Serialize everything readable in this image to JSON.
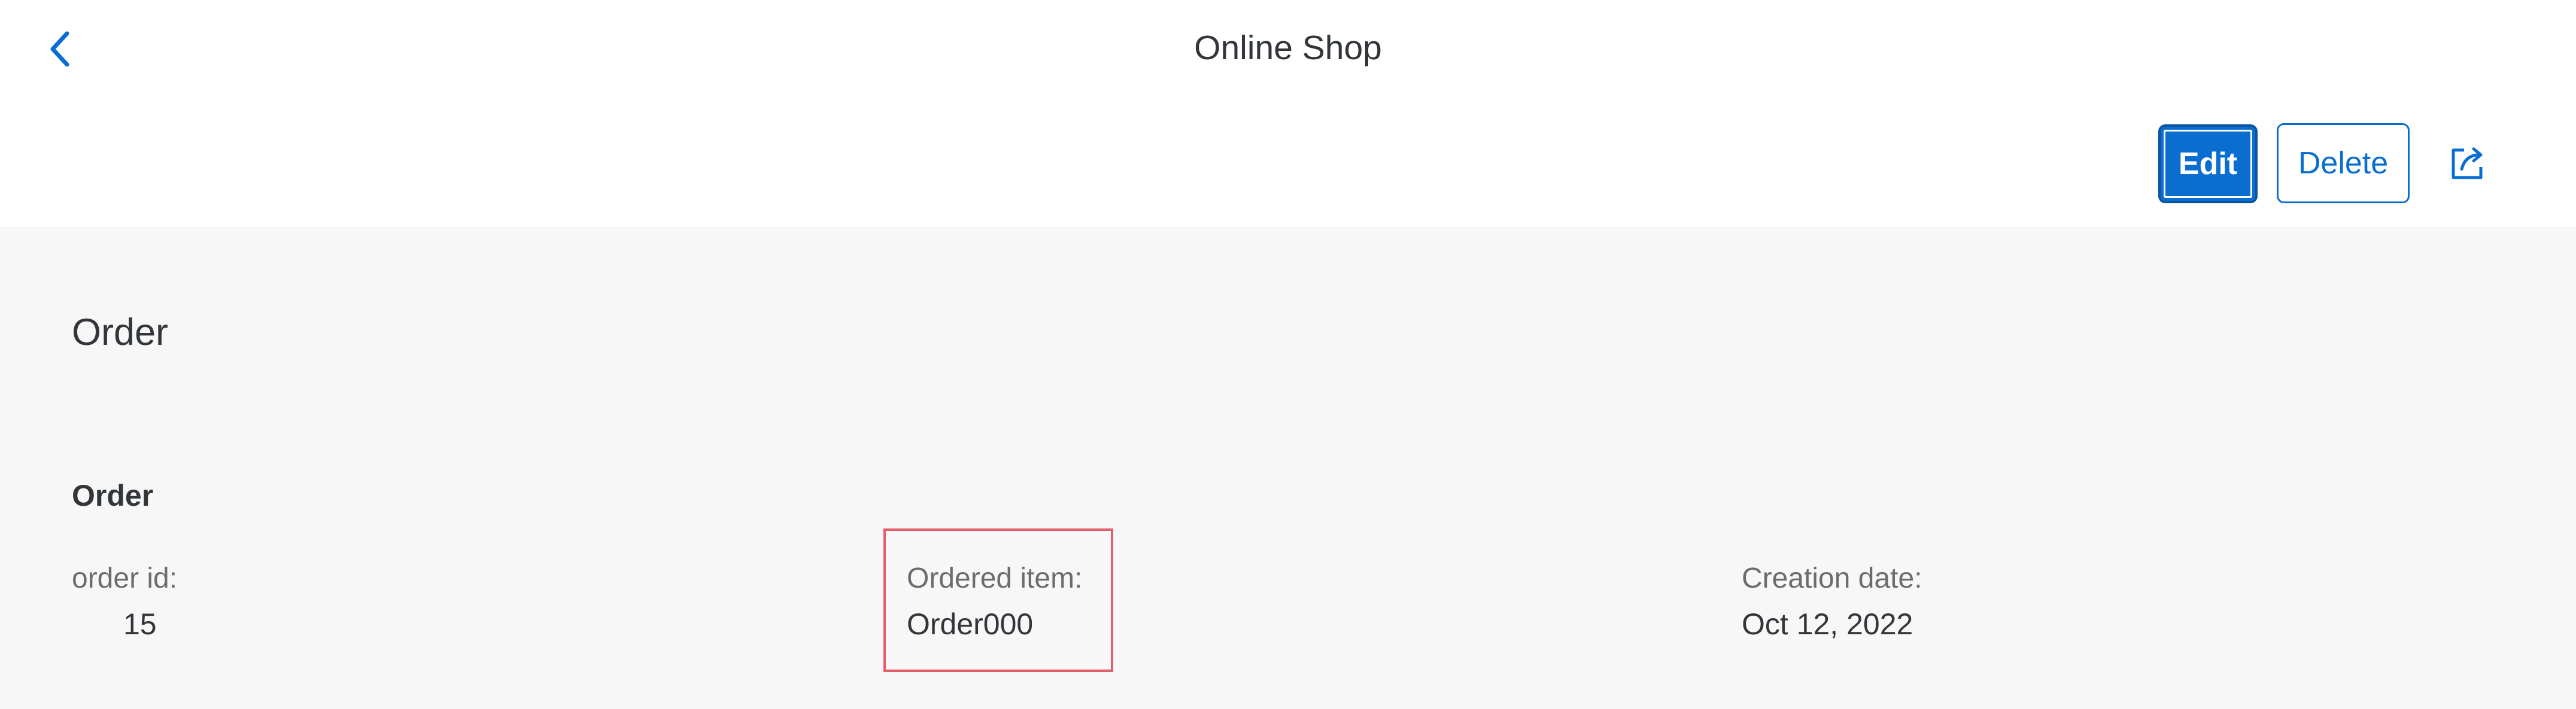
{
  "shell": {
    "title": "Online Shop",
    "back_icon": "chevron-left-icon"
  },
  "toolbar": {
    "edit_label": "Edit",
    "delete_label": "Delete",
    "share_icon": "share-icon"
  },
  "object": {
    "title": "Order"
  },
  "section": {
    "title": "Order",
    "fields": [
      {
        "label": "order id:",
        "value": "15"
      },
      {
        "label": "Ordered item:",
        "value": "Order000"
      },
      {
        "label": "Creation date:",
        "value": "Oct 12, 2022"
      }
    ]
  },
  "colors": {
    "accent": "#0a6ed1",
    "highlight": "#e35d6a",
    "content_background": "#f7f7f7"
  }
}
